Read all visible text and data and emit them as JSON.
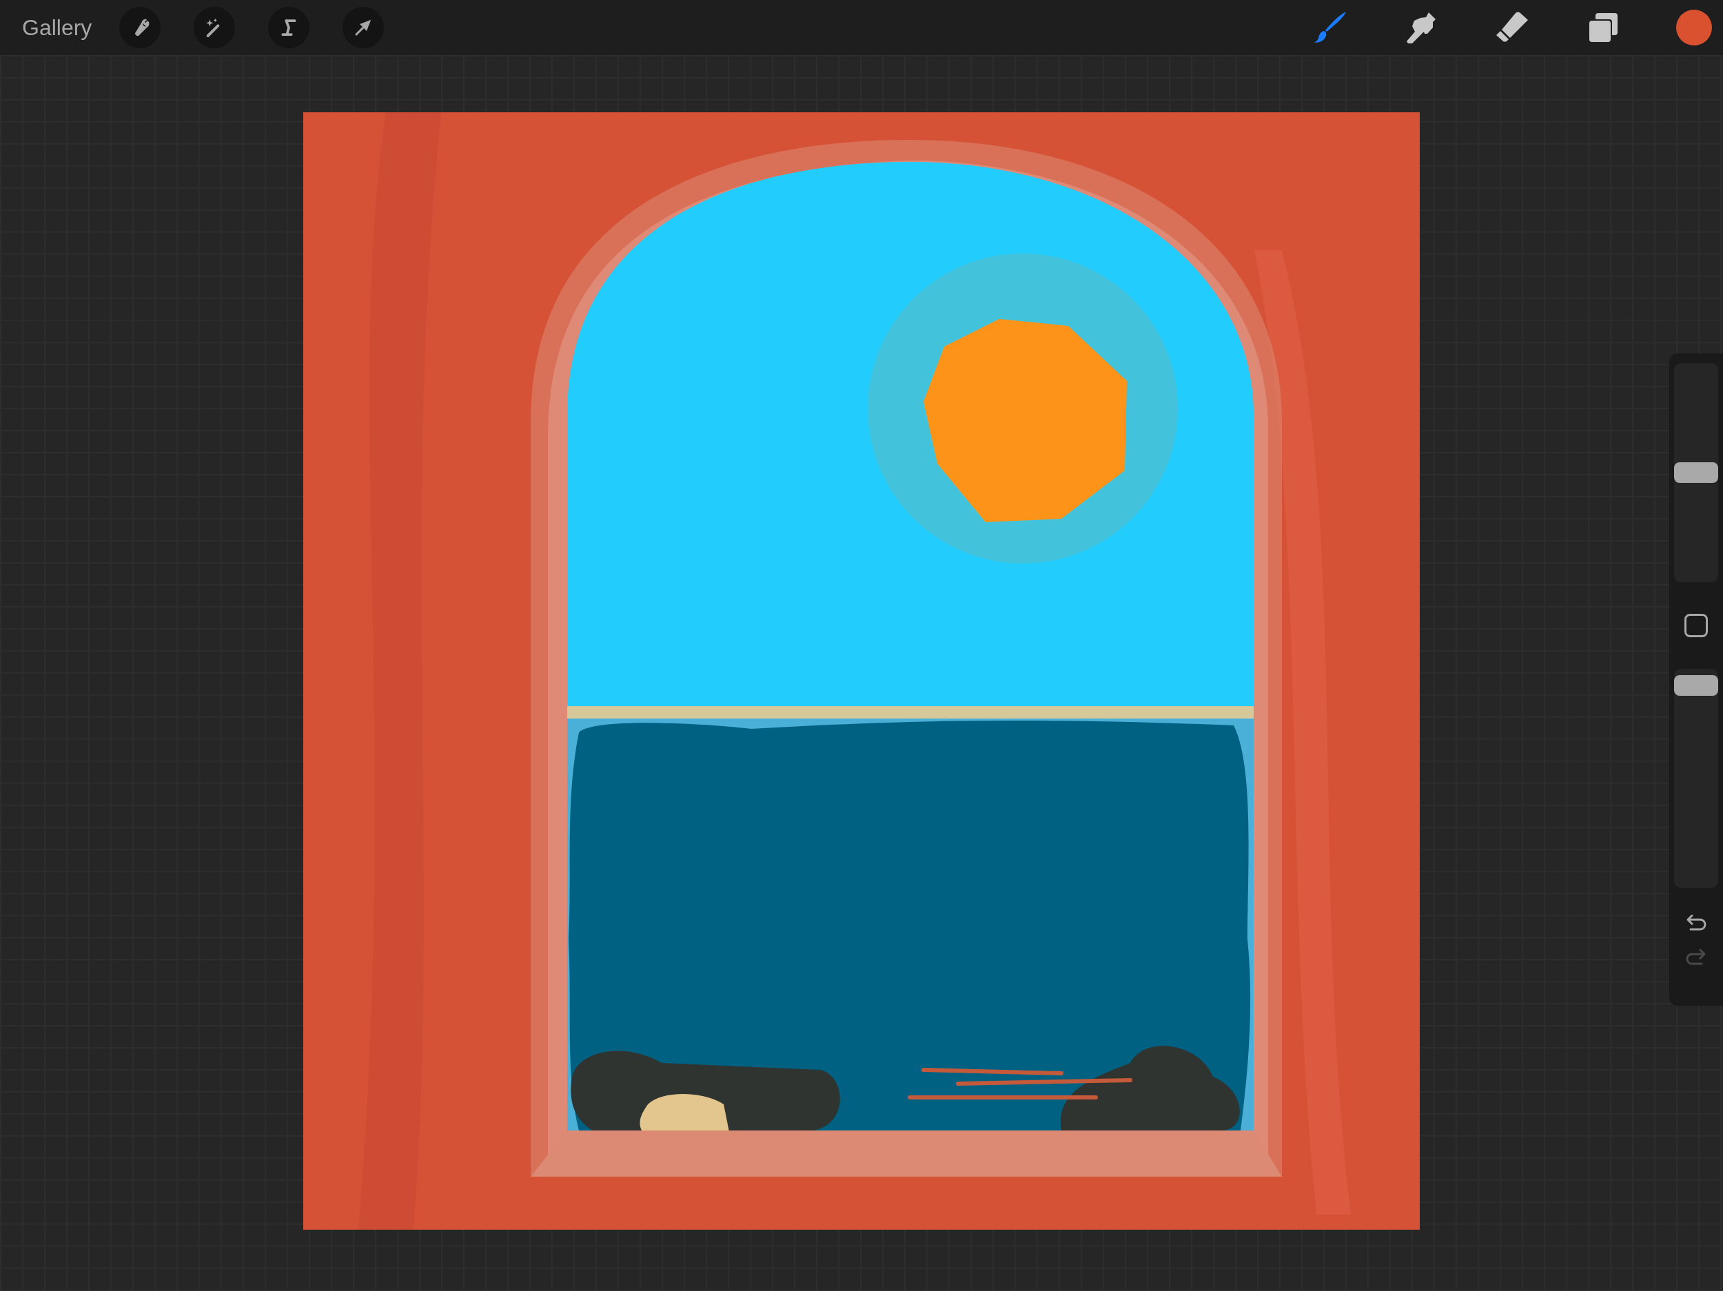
{
  "top_bar": {
    "gallery": "Gallery",
    "actions": [
      {
        "kind": "wrench"
      },
      {
        "kind": "wand"
      },
      {
        "kind": "selection"
      },
      {
        "kind": "transform"
      }
    ],
    "tools": [
      {
        "kind": "brush",
        "selected": true
      },
      {
        "kind": "smudge",
        "selected": false
      },
      {
        "kind": "eraser",
        "selected": false
      },
      {
        "kind": "layers",
        "selected": false
      }
    ],
    "current_color": {
      "color": "#d9512f"
    }
  },
  "sidebar": {
    "brush_size": {
      "level": 0.5
    },
    "opacity": {
      "level": 0.97
    },
    "undo": {
      "disabled": false
    },
    "redo": {
      "disabled": true
    }
  }
}
